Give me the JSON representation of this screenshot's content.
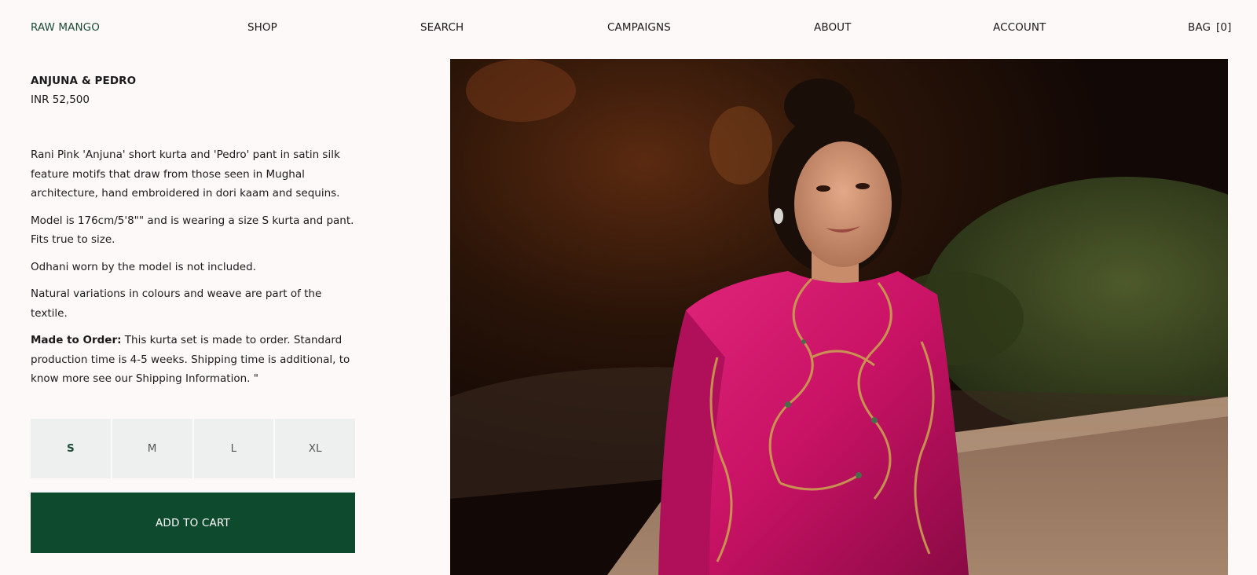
{
  "nav": {
    "brand": "RAW MANGO",
    "shop": "SHOP",
    "search": "SEARCH",
    "campaigns": "CAMPAIGNS",
    "about": "ABOUT",
    "account": "ACCOUNT",
    "bag_label": "BAG",
    "bag_count": "[0]"
  },
  "product": {
    "title": "ANJUNA & PEDRO",
    "price": "INR 52,500",
    "description": "Rani Pink 'Anjuna' short kurta and 'Pedro' pant in satin silk feature motifs that draw from those seen in Mughal architecture, hand embroidered in dori kaam and sequins.",
    "model_note": "Model is 176cm/5'8\"\" and is wearing a size S kurta and pant. Fits true to size.",
    "odhani_note": "Odhani worn by the model is not included.",
    "variation_note": "Natural variations in colours and weave are part of the textile.",
    "made_to_order_label": "Made to Order:",
    "made_to_order_text": " This kurta set is made to order. Standard production time is 4-5 weeks. Shipping time is additional, to know more see our Shipping Information. \""
  },
  "sizes": [
    {
      "label": "S",
      "selected": true
    },
    {
      "label": "M",
      "selected": false
    },
    {
      "label": "L",
      "selected": false
    },
    {
      "label": "XL",
      "selected": false
    }
  ],
  "cart_label": "ADD TO CART",
  "colors": {
    "brand_green": "#1c4d36",
    "cart_button": "#0d4a2e",
    "size_bg": "#eef0f0",
    "page_bg": "#fdf9f8",
    "kurta_pink": "#c81264"
  },
  "photo": {
    "subject": "product-model-photo"
  }
}
